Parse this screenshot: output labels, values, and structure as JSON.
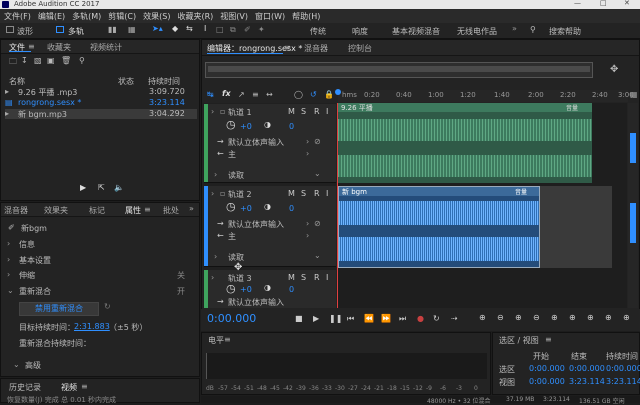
{
  "app": {
    "title": "Adobe Audition CC 2017"
  },
  "menu": [
    "文件(F)",
    "编辑(E)",
    "多轨(M)",
    "剪辑(C)",
    "效果(S)",
    "收藏夹(R)",
    "视图(V)",
    "窗口(W)",
    "帮助(H)"
  ],
  "toolbar": {
    "waveform": "波形",
    "multitrack": "多轨",
    "workspaces": [
      "传统",
      "响度",
      "基本视频混音",
      "无线电作品"
    ],
    "search": "搜索帮助"
  },
  "files": {
    "tabs": [
      "文件",
      "收藏夹",
      "视频统计"
    ],
    "col_name": "名称",
    "col_status": "状态",
    "col_duration": "持续时间",
    "items": [
      {
        "name": "9.26 平播 .mp3",
        "duration": "3:09.720"
      },
      {
        "name": "rongrong.sesx *",
        "duration": "3:23.114"
      },
      {
        "name": "新 bgm.mp3",
        "duration": "3:04.292"
      }
    ]
  },
  "props": {
    "tabs": [
      "混音器",
      "效果夹",
      "标记",
      "属性",
      "批处"
    ],
    "clip_name": "新bgm",
    "sections": [
      "信息",
      "基本设置",
      "伸缩",
      "重新混合"
    ],
    "stretch_state": "关",
    "remix_state": "开",
    "remix_button": "禁用重新混合",
    "target_label": "目标持续时间：",
    "target_value": "2:31.883",
    "target_tol": "（±5 秒）",
    "remix_dur_label": "重新混合持续时间：",
    "advanced": "高级",
    "bottom_tabs": [
      "历史记录",
      "视频"
    ],
    "status_left": "恢复数量(J) 完成 总 0.01 秒内完成"
  },
  "editor": {
    "tabs": [
      "编辑器：rongrong.sesx *",
      "混音器",
      "控制台"
    ],
    "fx": "fx",
    "ruler": [
      "hms",
      "0:20",
      "0:40",
      "1:00",
      "1:20",
      "1:40",
      "2:00",
      "2:20",
      "2:40",
      "3:00"
    ],
    "tracks": [
      {
        "name": "轨道 1",
        "vol": "+0",
        "pan": "0",
        "input": "默认立体声输入",
        "output": "主",
        "mode": "读取"
      },
      {
        "name": "轨道 2",
        "vol": "+0",
        "pan": "0",
        "input": "默认立体声输入",
        "output": "主",
        "mode": "读取"
      },
      {
        "name": "轨道 3",
        "vol": "+0",
        "pan": "0",
        "input": "默认立体声输入"
      }
    ],
    "clips": [
      {
        "name": "9.26 平播",
        "badge": "音量"
      },
      {
        "name": "新 bgm",
        "badge": "音量"
      }
    ],
    "timecode": "0:00.000"
  },
  "levels": {
    "title": "电平",
    "scale": [
      "dB",
      "-57",
      "-54",
      "-51",
      "-48",
      "-45",
      "-42",
      "-39",
      "-36",
      "-33",
      "-30",
      "-27",
      "-24",
      "-21",
      "-18",
      "-15",
      "-12",
      "-9",
      "-6",
      "-3",
      "0"
    ]
  },
  "selection": {
    "title": "选区 / 视图",
    "headers": [
      "开始",
      "结束",
      "持续时间"
    ],
    "rows": [
      {
        "label": "选区",
        "start": "0:00.000",
        "end": "0:00.000",
        "dur": "0:00.000"
      },
      {
        "label": "视图",
        "start": "0:00.000",
        "end": "3:23.114",
        "dur": "3:23.114"
      }
    ]
  },
  "status": {
    "format": "48000 Hz • 32 位混合",
    "size": "37.19 MB",
    "duration": "3:23.114",
    "free": "136.51 GB 空闲"
  }
}
